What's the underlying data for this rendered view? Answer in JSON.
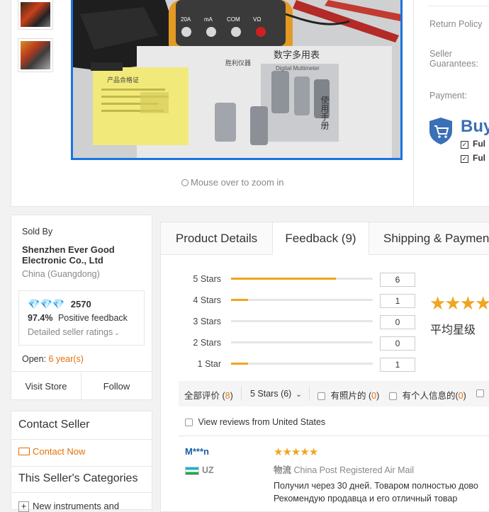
{
  "gallery": {
    "zoom_hint": "Mouse over to zoom in",
    "image_text_1": "数字多用表",
    "image_text_2": "Digital Multimeter",
    "image_text_3": "使用手册",
    "image_text_4": "胜利仪器",
    "image_text_5": "产品合格证",
    "meter_labels": [
      "20A",
      "mA",
      "COM",
      "VΩ"
    ]
  },
  "right_info": {
    "return_policy": "Return Policy",
    "seller_guarantees": "Seller Guarantees:",
    "payment": "Payment:",
    "buyer_title": "Buy",
    "full_1": "Ful",
    "full_2": "Ful"
  },
  "seller": {
    "sold_by": "Sold By",
    "name": "Shenzhen Ever Good Electronic Co., Ltd",
    "location": "China (Guangdong)",
    "score": "2570",
    "positive_pct": "97.4%",
    "positive_label": "Positive feedback",
    "detailed_ratings": "Detailed seller ratings",
    "open_label": "Open:",
    "open_years": "6 year(s)",
    "visit_store": "Visit Store",
    "follow": "Follow"
  },
  "contact": {
    "title": "Contact Seller",
    "contact_now": "Contact Now",
    "categories_title": "This Seller's Categories",
    "first_category": "New instruments and"
  },
  "tabs": [
    {
      "label": "Product Details"
    },
    {
      "label": "Feedback (9)"
    },
    {
      "label": "Shipping & Payment"
    }
  ],
  "ratings": [
    {
      "label": "5 Stars",
      "count": "6",
      "fraction": 0.74
    },
    {
      "label": "4 Stars",
      "count": "1",
      "fraction": 0.12
    },
    {
      "label": "3 Stars",
      "count": "0",
      "fraction": 0
    },
    {
      "label": "2 Stars",
      "count": "0",
      "fraction": 0
    },
    {
      "label": "1 Star",
      "count": "1",
      "fraction": 0.12
    }
  ],
  "average": {
    "label": "平均星级"
  },
  "filters": {
    "all_label": "全部评价 (",
    "all_count": "8",
    "close_paren": ")",
    "stars_select": "5 Stars (6)",
    "with_photos_label": "有照片的 (",
    "with_photos_count": "0",
    "personal_info_label": "有个人信息的(",
    "personal_info_count": "0",
    "view_us": "View reviews from United States"
  },
  "review": {
    "user": "M***n",
    "country": "UZ",
    "logistics_label": "物流",
    "logistics_value": "China Post Registered Air Mail",
    "text_1": "Получил через 30 дней. Товаром полностью дово",
    "text_2": "Рекомендую продавца и его отличный товар"
  }
}
